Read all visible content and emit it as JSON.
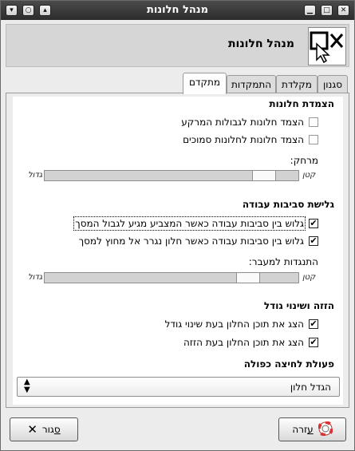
{
  "window": {
    "title": "מנהל חלונות",
    "buttons": {
      "close": "✕",
      "maximize": "□",
      "shade": "▴",
      "pin": "○",
      "menu": "▾"
    }
  },
  "header": {
    "title": "מנהל חלונות",
    "logo_icon": "window-manager-icon"
  },
  "tabs": [
    {
      "label": "סגנון"
    },
    {
      "label": "מקלדת"
    },
    {
      "label": "התמקדות"
    },
    {
      "label": "מתקדם"
    }
  ],
  "active_tab": "מתקדם",
  "snapping": {
    "title": "הצמדת חלונות",
    "options": [
      {
        "label": "הצמד חלונות לגבולות המרקע",
        "checked": false
      },
      {
        "label": "הצמד חלונות לחלונות סמוכים",
        "checked": false
      }
    ],
    "distance": {
      "label": "מרחק:",
      "min_label": "קטן",
      "max_label": "גדול",
      "value": 0.11
    }
  },
  "workspace_wrap": {
    "title": "גלישת סביבות עבודה",
    "options": [
      {
        "label": "גלוש בין סביבות עבודה כאשר המצביע מגיע לגבול המסך",
        "checked": true
      },
      {
        "label": "גלוש בין סביבות עבודה כאשר חלון נגרר אל מחוץ למסך",
        "checked": true
      }
    ],
    "resistance": {
      "label": "התנגדות למעבר:",
      "min_label": "קטן",
      "max_label": "גדול",
      "value": 0.2
    }
  },
  "move_resize": {
    "title": "הזזה ושינוי גודל",
    "options": [
      {
        "label": "הצג את תוכן החלון בעת שינוי גודל",
        "checked": true
      },
      {
        "label": "הצג את תוכן החלון בעת הזזה",
        "checked": true
      }
    ]
  },
  "double_click": {
    "title": "פעולת לחיצה כפולה",
    "selected": "הגדל חלון"
  },
  "footer": {
    "close_label": "סגור",
    "close_mnemonic": "ס",
    "close_rest": "גור",
    "help_mnemonic": "ע",
    "help_rest": "זרה"
  }
}
